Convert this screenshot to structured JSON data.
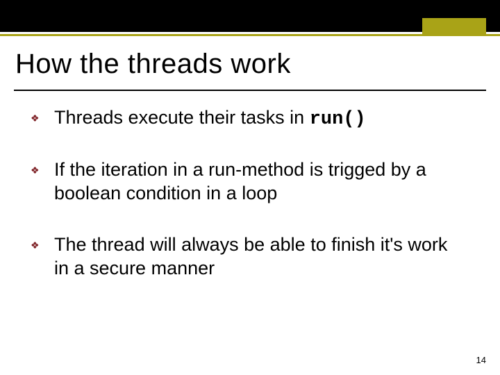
{
  "header": {
    "title": "How the threads work"
  },
  "bullets": [
    {
      "text_before": "Threads execute their tasks in ",
      "code": "run()",
      "text_after": ""
    },
    {
      "text_before": "If the iteration in a run-method is trigged by a boolean condition in a loop",
      "code": "",
      "text_after": ""
    },
    {
      "text_before": "The thread will always be able to finish it's work in a secure manner",
      "code": "",
      "text_after": ""
    }
  ],
  "page_number": "14",
  "icons": {
    "bullet_glyph": "❖"
  }
}
